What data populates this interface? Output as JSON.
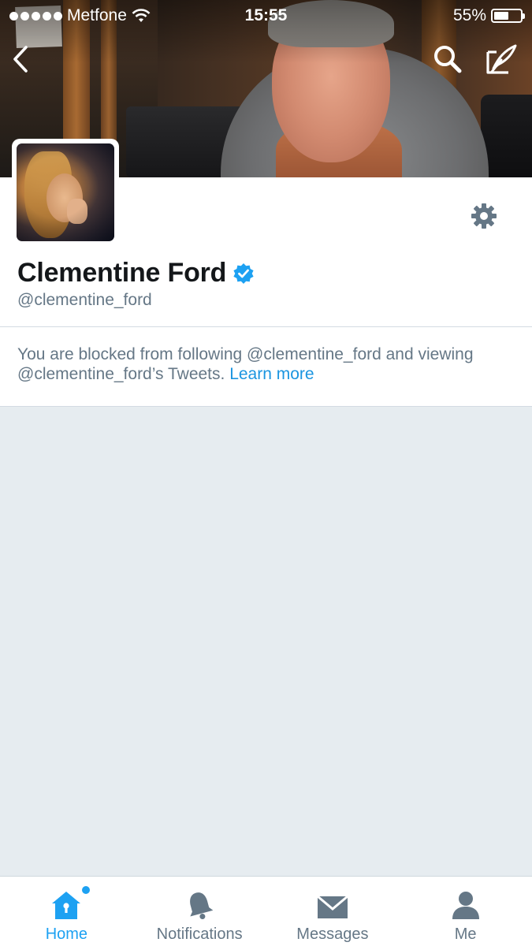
{
  "status_bar": {
    "carrier": "Metfone",
    "time": "15:55",
    "battery_percent": "55%",
    "battery_level": 0.55,
    "signal_bars": 5
  },
  "header": {
    "back_icon": "chevron-left-icon",
    "search_icon": "search-icon",
    "compose_icon": "compose-tweet-icon"
  },
  "profile": {
    "display_name": "Clementine Ford",
    "handle": "@clementine_ford",
    "verified": true,
    "settings_icon": "gear-icon"
  },
  "blocked_notice": {
    "line1": "You are blocked from following @clementine_ford and viewing",
    "line2": "@clementine_ford’s Tweets.",
    "link": "Learn more"
  },
  "tab_bar": {
    "tabs": [
      {
        "label": "Home",
        "icon": "home-icon",
        "active": true,
        "has_dot": true
      },
      {
        "label": "Notifications",
        "icon": "bell-icon",
        "active": false
      },
      {
        "label": "Messages",
        "icon": "envelope-icon",
        "active": false
      },
      {
        "label": "Me",
        "icon": "person-icon",
        "active": false
      }
    ]
  },
  "colors": {
    "accent": "#1da1f2",
    "link": "#1b95e0",
    "muted_text": "#657786",
    "background": "#e6ecf0",
    "verified_badge": "#1da1f2"
  }
}
